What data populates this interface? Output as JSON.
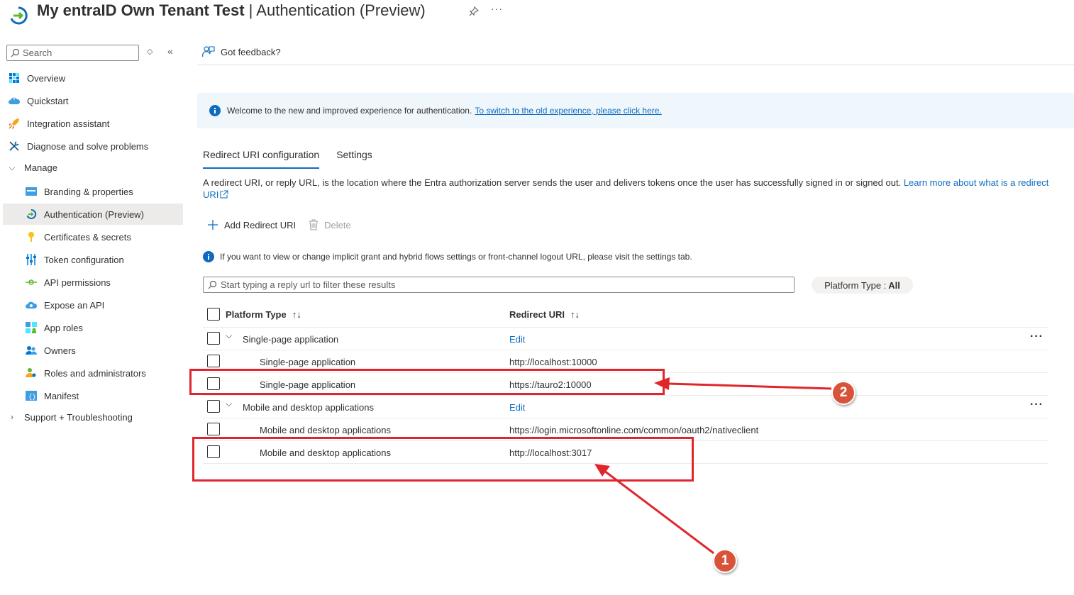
{
  "header": {
    "title_bold": "My entraID Own Tenant Test",
    "title_sep": " | ",
    "title_rest": "Authentication (Preview)",
    "more": "···"
  },
  "sidebar": {
    "search_placeholder": "Search",
    "items": [
      {
        "label": "Overview",
        "icon": "overview-icon"
      },
      {
        "label": "Quickstart",
        "icon": "quickstart-icon"
      },
      {
        "label": "Integration assistant",
        "icon": "rocket-icon"
      },
      {
        "label": "Diagnose and solve problems",
        "icon": "wrench-icon"
      },
      {
        "label": "Manage",
        "icon": "chevron-down-icon"
      },
      {
        "label": "Branding & properties",
        "icon": "branding-icon"
      },
      {
        "label": "Authentication (Preview)",
        "icon": "authentication-icon"
      },
      {
        "label": "Certificates & secrets",
        "icon": "key-icon"
      },
      {
        "label": "Token configuration",
        "icon": "token-icon"
      },
      {
        "label": "API permissions",
        "icon": "api-permissions-icon"
      },
      {
        "label": "Expose an API",
        "icon": "cloud-icon"
      },
      {
        "label": "App roles",
        "icon": "app-roles-icon"
      },
      {
        "label": "Owners",
        "icon": "owners-icon"
      },
      {
        "label": "Roles and administrators",
        "icon": "roles-icon"
      },
      {
        "label": "Manifest",
        "icon": "manifest-icon"
      },
      {
        "label": "Support + Troubleshooting",
        "icon": "chevron-right-icon"
      }
    ]
  },
  "main": {
    "feedback": "Got feedback?",
    "banner_text": "Welcome to the new and improved experience for authentication.",
    "banner_link": "To switch to the old experience, please click here.",
    "tabs": [
      {
        "label": "Redirect URI configuration",
        "active": true
      },
      {
        "label": "Settings",
        "active": false
      }
    ],
    "description": "A redirect URI, or reply URL, is the location where the Entra authorization server sends the user and delivers tokens once the user has successfully signed in or signed out.",
    "learn_more": "Learn more about what is a redirect URI",
    "cmd_add": "Add Redirect URI",
    "cmd_delete": "Delete",
    "info_text": "If you want to view or change implicit grant and hybrid flows settings or front-channel logout URL, please visit the settings tab.",
    "filter_placeholder": "Start typing a reply url to filter these results",
    "platform_pill_label": "Platform Type :",
    "platform_pill_value": "All"
  },
  "table": {
    "col_platform": "Platform Type",
    "col_redirect": "Redirect URI",
    "sort_glyph": "↑↓",
    "rows": [
      {
        "platform": "Single-page application",
        "uri": "Edit",
        "group": true
      },
      {
        "platform": "Single-page application",
        "uri": "http://localhost:10000",
        "group": false
      },
      {
        "platform": "Single-page application",
        "uri": "https://tauro2:10000",
        "group": false
      },
      {
        "platform": "Mobile and desktop applications",
        "uri": "Edit",
        "group": true
      },
      {
        "platform": "Mobile and desktop applications",
        "uri": "https://login.microsoftonline.com/common/oauth2/nativeclient",
        "group": false
      },
      {
        "platform": "Mobile and desktop applications",
        "uri": "http://localhost:3017",
        "group": false
      }
    ],
    "row_more": "···"
  },
  "annotations": {
    "badge1": "1",
    "badge2": "2",
    "color": "#e0262b"
  }
}
